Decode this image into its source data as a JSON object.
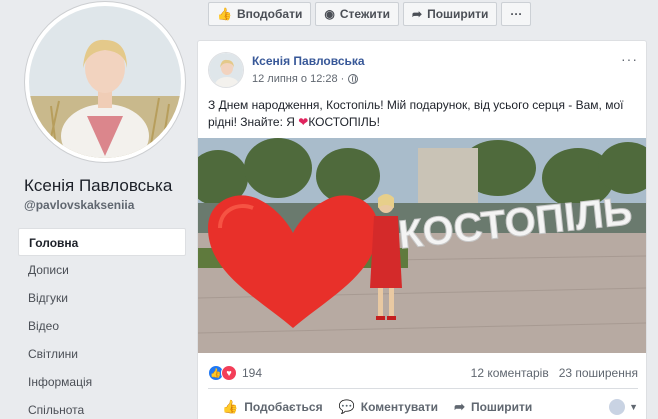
{
  "profile": {
    "name": "Ксенія Павловська",
    "handle": "@pavlovskakseniia"
  },
  "nav": {
    "items": [
      {
        "label": "Головна",
        "active": true
      },
      {
        "label": "Дописи"
      },
      {
        "label": "Відгуки"
      },
      {
        "label": "Відео"
      },
      {
        "label": "Світлини"
      },
      {
        "label": "Інформація"
      },
      {
        "label": "Спільнота"
      }
    ]
  },
  "actions": {
    "like": "Вподобати",
    "follow": "Стежити",
    "share": "Поширити",
    "more": "···"
  },
  "post": {
    "author": "Ксенія Павловська",
    "timestamp": "12 липня о 12:28 ·",
    "menu": "···",
    "text_before": "З Днем народження, Костопіль! Мій подарунок, від усього серця - Вам, мої рідні! Знайте: Я ",
    "heart": "❤",
    "text_after": "КОСТОПІЛЬ!",
    "image_sign": "КОСТОПІЛЬ",
    "reactions_count": "194",
    "comments": "12 коментарів",
    "shares": "23 поширення",
    "footer": {
      "like": "Подобається",
      "comment": "Коментувати",
      "share": "Поширити"
    }
  },
  "colors": {
    "brand_blue": "#385898",
    "like_blue": "#2078f4",
    "love_red": "#f33e58",
    "heart_red": "#e8302a"
  }
}
